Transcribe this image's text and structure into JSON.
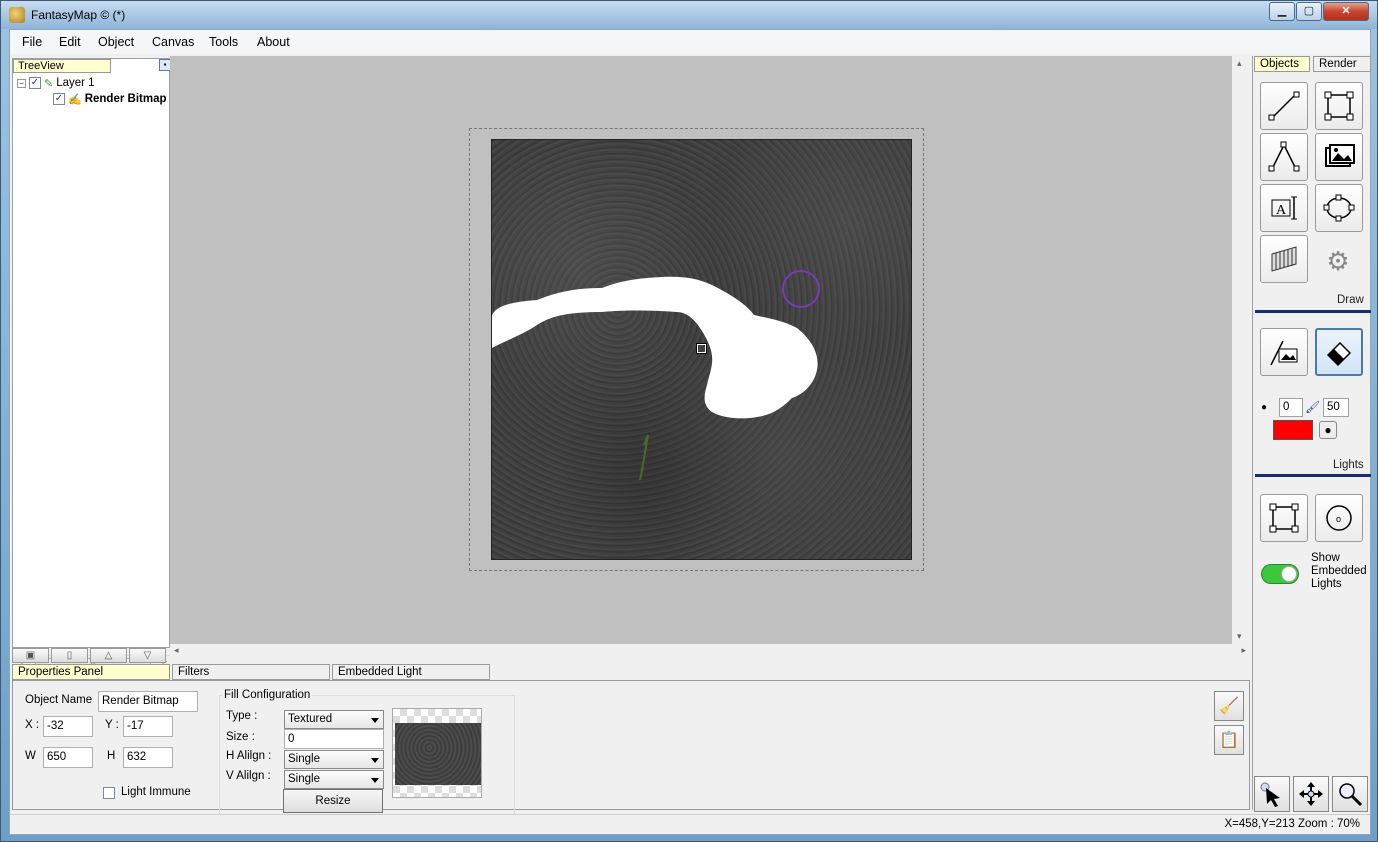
{
  "window": {
    "title": "FantasyMap © (*)",
    "min": "▁",
    "max": "▢",
    "close": "✕"
  },
  "menu": [
    "File",
    "Edit",
    "Object",
    "Canvas",
    "Tools",
    "About"
  ],
  "tree": {
    "tab": "TreeView",
    "layer": "Layer 1",
    "child": "Render Bitmap"
  },
  "right_panel": {
    "tabs": [
      "Objects",
      "Render"
    ],
    "draw_label": "Draw",
    "lights_label": "Lights",
    "brush_size": "0",
    "brush_opacity": "50",
    "brush_color": "#ff0000",
    "show_embedded_lights": "Show Embedded Lights",
    "toggle_on": true
  },
  "bottom": {
    "tabs": [
      "Properties Panel",
      "Filters",
      "Embedded Light"
    ],
    "object_name_label": "Object Name",
    "object_name": "Render Bitmap",
    "x_label": "X :",
    "x": "-32",
    "y_label": "Y :",
    "y": "-17",
    "w_label": "W",
    "w": "650",
    "h_label": "H",
    "h": "632",
    "light_immune": "Light Immune",
    "fill_config": "Fill Configuration",
    "type_label": "Type :",
    "type_value": "Textured",
    "size_label": "Size :",
    "size_value": "0",
    "halign_label": "H Alilgn :",
    "halign_value": "Single",
    "valign_label": "V Alilgn :",
    "valign_value": "Single",
    "resize": "Resize"
  },
  "status": {
    "text": "X=458,Y=213  Zoom : 70%"
  },
  "colors": {
    "accent": "#1a2a7a",
    "tree_tab": "#ffffcf",
    "toggle": "#3cc83c",
    "cursor_circle": "#7a3ab8"
  }
}
